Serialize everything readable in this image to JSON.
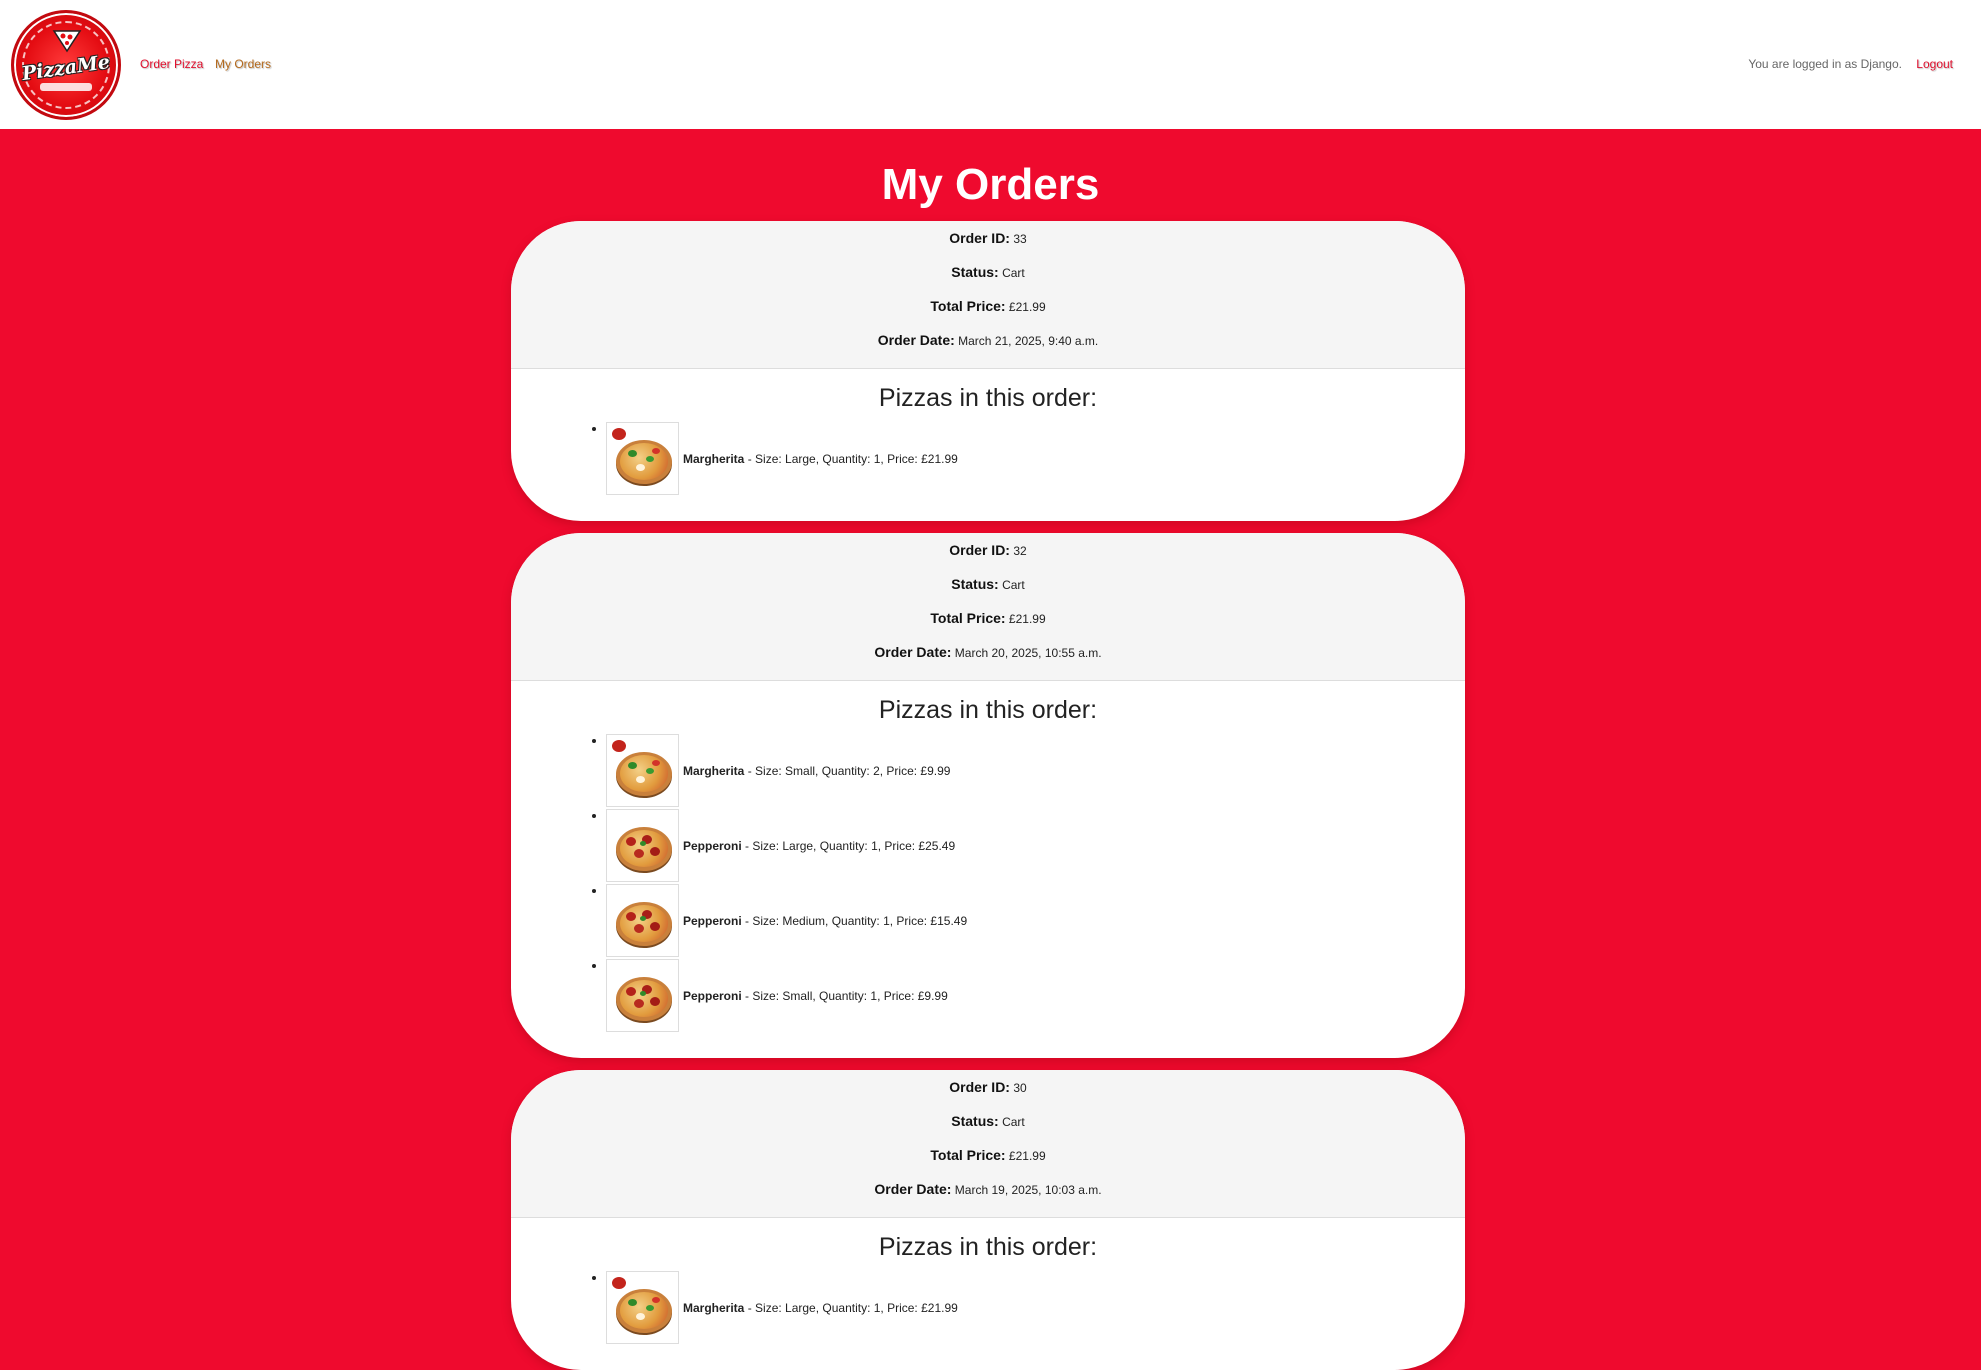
{
  "header": {
    "logo_text": "PizzaMe",
    "nav": {
      "order_pizza": "Order Pizza",
      "my_orders": "My Orders"
    },
    "user_text": "You are logged in as Django.",
    "logout": "Logout"
  },
  "page": {
    "title": "My Orders"
  },
  "labels": {
    "order_id": "Order ID:",
    "status": "Status:",
    "total_price": "Total Price:",
    "order_date": "Order Date:",
    "pizzas_heading": "Pizzas in this order:"
  },
  "orders": [
    {
      "id": "33",
      "status": "Cart",
      "total": "£21.99",
      "date": "March 21, 2025, 9:40 a.m.",
      "items": [
        {
          "name": "Margherita",
          "details": " - Size: Large, Quantity: 1, Price: £21.99",
          "image": "margherita-photo"
        }
      ]
    },
    {
      "id": "32",
      "status": "Cart",
      "total": "£21.99",
      "date": "March 20, 2025, 10:55 a.m.",
      "items": [
        {
          "name": "Margherita",
          "details": " - Size: Small, Quantity: 2, Price: £9.99",
          "image": "margherita-photo"
        },
        {
          "name": "Pepperoni",
          "details": " - Size: Large, Quantity: 1, Price: £25.49",
          "image": "pepperoni-photo"
        },
        {
          "name": "Pepperoni",
          "details": " - Size: Medium, Quantity: 1, Price: £15.49",
          "image": "pepperoni-photo"
        },
        {
          "name": "Pepperoni",
          "details": " - Size: Small, Quantity: 1, Price: £9.99",
          "image": "pepperoni-photo"
        }
      ]
    },
    {
      "id": "30",
      "status": "Cart",
      "total": "£21.99",
      "date": "March 19, 2025, 10:03 a.m.",
      "items": [
        {
          "name": "Margherita",
          "details": " - Size: Large, Quantity: 1, Price: £21.99",
          "image": "margherita-photo"
        }
      ]
    }
  ],
  "colors": {
    "background": "#ef0a2e",
    "card": "#ffffff",
    "card_header": "#f5f5f5",
    "link": "#e0102e",
    "active_link": "#b46a1e"
  }
}
